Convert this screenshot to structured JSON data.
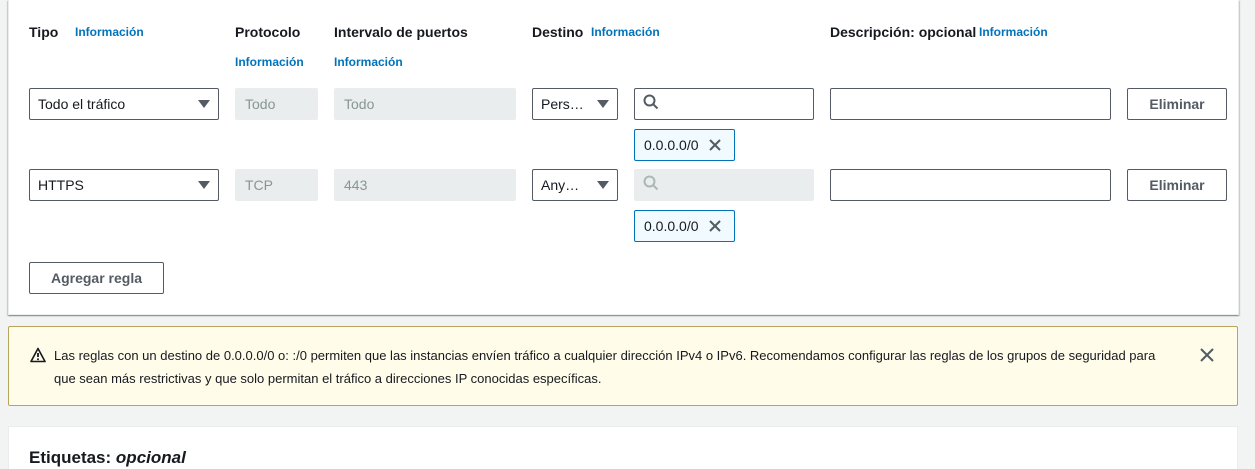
{
  "header": {
    "tipo": "Tipo",
    "protocolo": "Protocolo",
    "intervalo": "Intervalo de puertos",
    "destino": "Destino",
    "descripcion": "Descripción: opcional",
    "info": "Información"
  },
  "rules": [
    {
      "tipo": "Todo el tráfico",
      "protocolo": "Todo",
      "puertos": "Todo",
      "destino": "Pers…",
      "search_placeholder": "",
      "search_disabled": false,
      "token": "0.0.0.0/0",
      "descripcion": "",
      "remove_label": "Eliminar"
    },
    {
      "tipo": "HTTPS",
      "protocolo": "TCP",
      "puertos": "443",
      "destino": "Any…",
      "search_placeholder": "",
      "search_disabled": true,
      "token": "0.0.0.0/0",
      "descripcion": "",
      "remove_label": "Eliminar"
    }
  ],
  "add_rule_label": "Agregar regla",
  "warning": {
    "text": "Las reglas con un destino de 0.0.0.0/0 o: :/0 permiten que las instancias envíen tráfico a cualquier dirección IPv4 o IPv6. Recomendamos configurar las reglas de los grupos de seguridad para que sean más restrictivas y que solo permitan el tráfico a direcciones IP conocidas específicas.",
    "icon": "warning-icon",
    "close_icon": "close-icon"
  },
  "tags": {
    "title": "Etiquetas:",
    "optional": "opcional"
  },
  "colors": {
    "link": "#0073bb",
    "warning_bg": "#fffce9",
    "warning_border": "#b8a45d",
    "token_border": "#0073bb",
    "disabled_bg": "#eaeded"
  }
}
